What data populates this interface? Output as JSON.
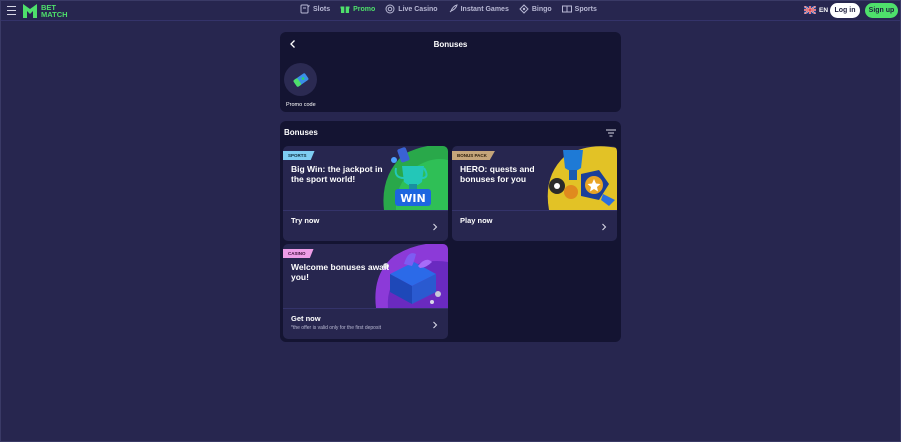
{
  "brand": {
    "line1": "BET",
    "line2": "MATCH"
  },
  "nav": [
    {
      "label": "Slots",
      "icon": "slots-icon"
    },
    {
      "label": "Promo",
      "icon": "gift-icon",
      "active": true
    },
    {
      "label": "Live Casino",
      "icon": "chip-icon"
    },
    {
      "label": "Instant Games",
      "icon": "rocket-icon"
    },
    {
      "label": "Bingo",
      "icon": "bingo-icon"
    },
    {
      "label": "Sports",
      "icon": "sports-icon"
    }
  ],
  "header": {
    "lang": "EN",
    "login_label": "Log in",
    "signup_label": "Sign up"
  },
  "top_panel": {
    "title": "Bonuses",
    "promo_label": "Promo code"
  },
  "bonuses": {
    "title": "Bonuses",
    "cards": [
      {
        "tag": "SPORTS",
        "title": "Big Win: the jackpot in the sport world!",
        "cta": "Try now",
        "art_text": "WIN"
      },
      {
        "tag": "BONUS PACK",
        "title": "HERO: quests and bonuses for you",
        "cta": "Play now"
      },
      {
        "tag": "CASINO",
        "title": "Welcome bonuses await you!",
        "cta": "Get now",
        "note": "*the offer is valid only for the first deposit"
      }
    ]
  },
  "colors": {
    "background": "#27264f",
    "panel": "#141432",
    "accent": "#4ee06b"
  }
}
